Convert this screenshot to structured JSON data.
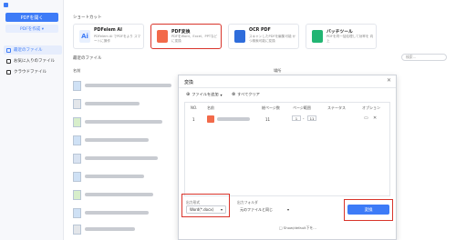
{
  "sidebar": {
    "open_pdf_label": "PDFを開く",
    "create_pdf_label": "PDFを作成 ▾",
    "items": [
      {
        "label": "最近のファイル",
        "icon": "clock-icon"
      },
      {
        "label": "お気に入りのファイル",
        "icon": "star-icon"
      },
      {
        "label": "クラウドファイル",
        "icon": "cloud-icon"
      }
    ]
  },
  "shortcuts": {
    "title": "ショートカット",
    "cards": [
      {
        "title": "PDFelem AI",
        "desc": "PDFelem AI でPDFをより スマートに操作",
        "icon": "ai-icon",
        "color": "#3d7bf7"
      },
      {
        "title": "PDF変換",
        "desc": "PDFをWord、Excel、PPTなど に変換",
        "icon": "pdf-convert-icon",
        "color": "#f26a4a"
      },
      {
        "title": "OCR PDF",
        "desc": "スキャンしたPDFを編集可能 かつ検索可能に変換",
        "icon": "ocr-icon",
        "color": "#2f6ddb"
      },
      {
        "title": "バッチツール",
        "desc": "PDFを同一括処理して効率を 向上",
        "icon": "batch-icon",
        "color": "#22b573"
      }
    ]
  },
  "recent": {
    "title": "最近のファイル",
    "col_name": "名前",
    "col_modified": "場所",
    "search_placeholder": "検索..."
  },
  "dialog": {
    "title": "変換",
    "close": "✕",
    "add_files_label": "ファイルを追加",
    "clear_all_label": "すべてクリア",
    "headers": [
      "NO.",
      "名前",
      "総ページ数",
      "ページ範囲",
      "ステータス",
      "オプション"
    ],
    "row": {
      "no": "1",
      "total_pages": "11",
      "range_from": "1",
      "range_to": "11"
    },
    "output_format_label": "出力形式",
    "output_format_value": "Word(*.docx)",
    "output_folder_label": "出力フォルダ",
    "output_folder_value": "元のファイルと同じ",
    "convert_label": "変換",
    "checkbox_label": "□ Show/default下を..."
  },
  "colors": {
    "accent": "#3d7bf7",
    "highlight": "#d9342b"
  }
}
